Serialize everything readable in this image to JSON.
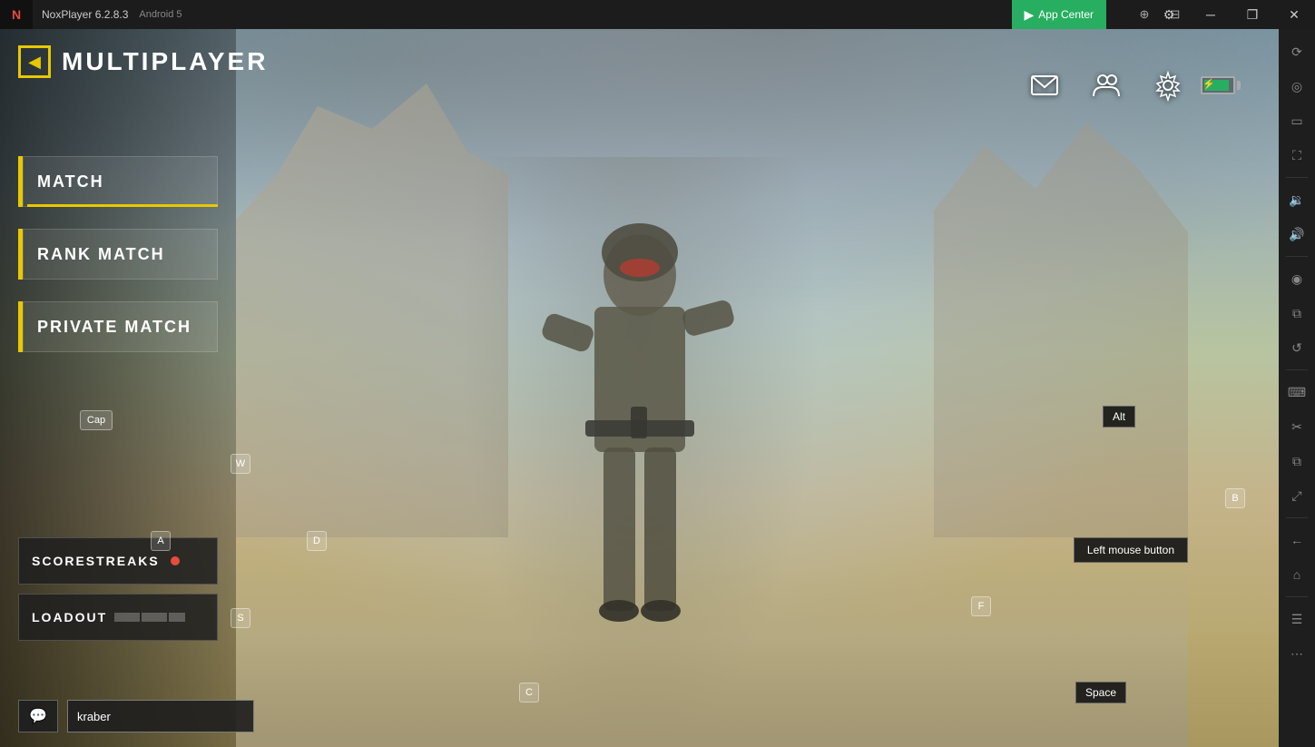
{
  "titlebar": {
    "logo": "N",
    "appname": "NoxPlayer 6.2.8.3",
    "android": "Android 5",
    "appcenter_label": "App Center",
    "controls": {
      "bookmark": "🔖",
      "minimize": "─",
      "restore": "❐",
      "close": "✕",
      "fullscreen_exit": "⊡"
    }
  },
  "game": {
    "page_title": "MULTIPLAYER",
    "back_label": "←",
    "menu_items": [
      {
        "id": "match",
        "label": "MATCH"
      },
      {
        "id": "rank-match",
        "label": "RANK MATCH"
      },
      {
        "id": "private-match",
        "label": "PRIVATE MATCH"
      }
    ],
    "bottom_buttons": [
      {
        "id": "scorestreaks",
        "label": "SCORESTREAKS",
        "has_dot": true
      },
      {
        "id": "loadout",
        "label": "LOADOUT"
      }
    ],
    "username": "kraber",
    "key_hints": {
      "cap": "Cap",
      "w": "W",
      "a": "A",
      "d": "D",
      "s": "S",
      "f": "F",
      "b": "B",
      "c": "C"
    },
    "tooltips": {
      "alt": "Alt",
      "lmb": "Left mouse button",
      "space": "Space"
    },
    "top_icons": {
      "mail": "✉",
      "friends": "👥",
      "settings": "⚙"
    }
  },
  "sidebar": {
    "buttons": [
      {
        "id": "rotate",
        "icon": "⟳"
      },
      {
        "id": "location",
        "icon": "◎"
      },
      {
        "id": "screen",
        "icon": "▭"
      },
      {
        "id": "fullscreen",
        "icon": "⛶"
      },
      {
        "id": "vol-down",
        "icon": "🔉"
      },
      {
        "id": "vol-up",
        "icon": "🔊"
      },
      {
        "id": "screenshot",
        "icon": "◉"
      },
      {
        "id": "multi",
        "icon": "⧉"
      },
      {
        "id": "refresh",
        "icon": "↺"
      },
      {
        "id": "keyboard",
        "icon": "⌨"
      },
      {
        "id": "scissors",
        "icon": "✂"
      },
      {
        "id": "copy",
        "icon": "⧉"
      },
      {
        "id": "resize",
        "icon": "⤢"
      },
      {
        "id": "menu",
        "icon": "☰"
      },
      {
        "id": "dots",
        "icon": "⋯"
      }
    ]
  }
}
